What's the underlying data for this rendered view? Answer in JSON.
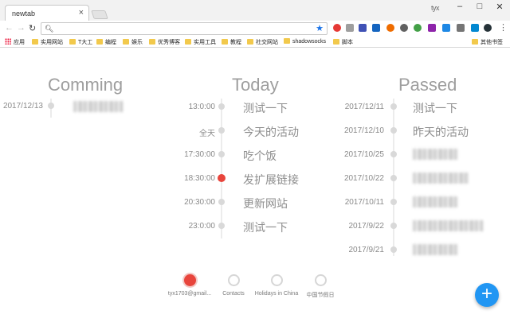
{
  "browser": {
    "tab_title": "newtab",
    "profile_name": "tyx",
    "bookmarks": [
      "应用",
      "实用网站",
      "T大工",
      "编程",
      "娱乐",
      "优秀博客",
      "实用工具",
      "教程",
      "社交网站",
      "shadowsocks",
      "脚本"
    ],
    "bookmarks_other": "其他书签"
  },
  "columns": {
    "comming": {
      "heading": "Comming",
      "items": [
        {
          "date": "2017/12/13",
          "title": ""
        }
      ]
    },
    "today": {
      "heading": "Today",
      "items": [
        {
          "time": "13:0:00",
          "title": "测试一下",
          "active": false
        },
        {
          "time": "全天",
          "title": "今天的活动",
          "active": false
        },
        {
          "time": "17:30:00",
          "title": "吃个饭",
          "active": false
        },
        {
          "time": "18:30:00",
          "title": "发扩展链接",
          "active": true
        },
        {
          "time": "20:30:00",
          "title": "更新网站",
          "active": false
        },
        {
          "time": "23:0:00",
          "title": "测试一下",
          "active": false
        }
      ]
    },
    "passed": {
      "heading": "Passed",
      "items": [
        {
          "date": "2017/12/11",
          "title": "测试一下"
        },
        {
          "date": "2017/12/10",
          "title": "昨天的活动"
        },
        {
          "date": "2017/10/25",
          "title": ""
        },
        {
          "date": "2017/10/22",
          "title": ""
        },
        {
          "date": "2017/10/11",
          "title": ""
        },
        {
          "date": "2017/9/22",
          "title": ""
        },
        {
          "date": "2017/9/21",
          "title": ""
        }
      ]
    }
  },
  "calendars": [
    {
      "label": "tyx1703@gmail...",
      "selected": true
    },
    {
      "label": "Contacts",
      "selected": false
    },
    {
      "label": "Holidays in China",
      "selected": false
    },
    {
      "label": "中国节假日",
      "selected": false
    }
  ],
  "fab_label": "+",
  "colors": {
    "accent_red": "#e8453c",
    "fab_blue": "#2196f3",
    "text_gray": "#8d8d8d"
  }
}
